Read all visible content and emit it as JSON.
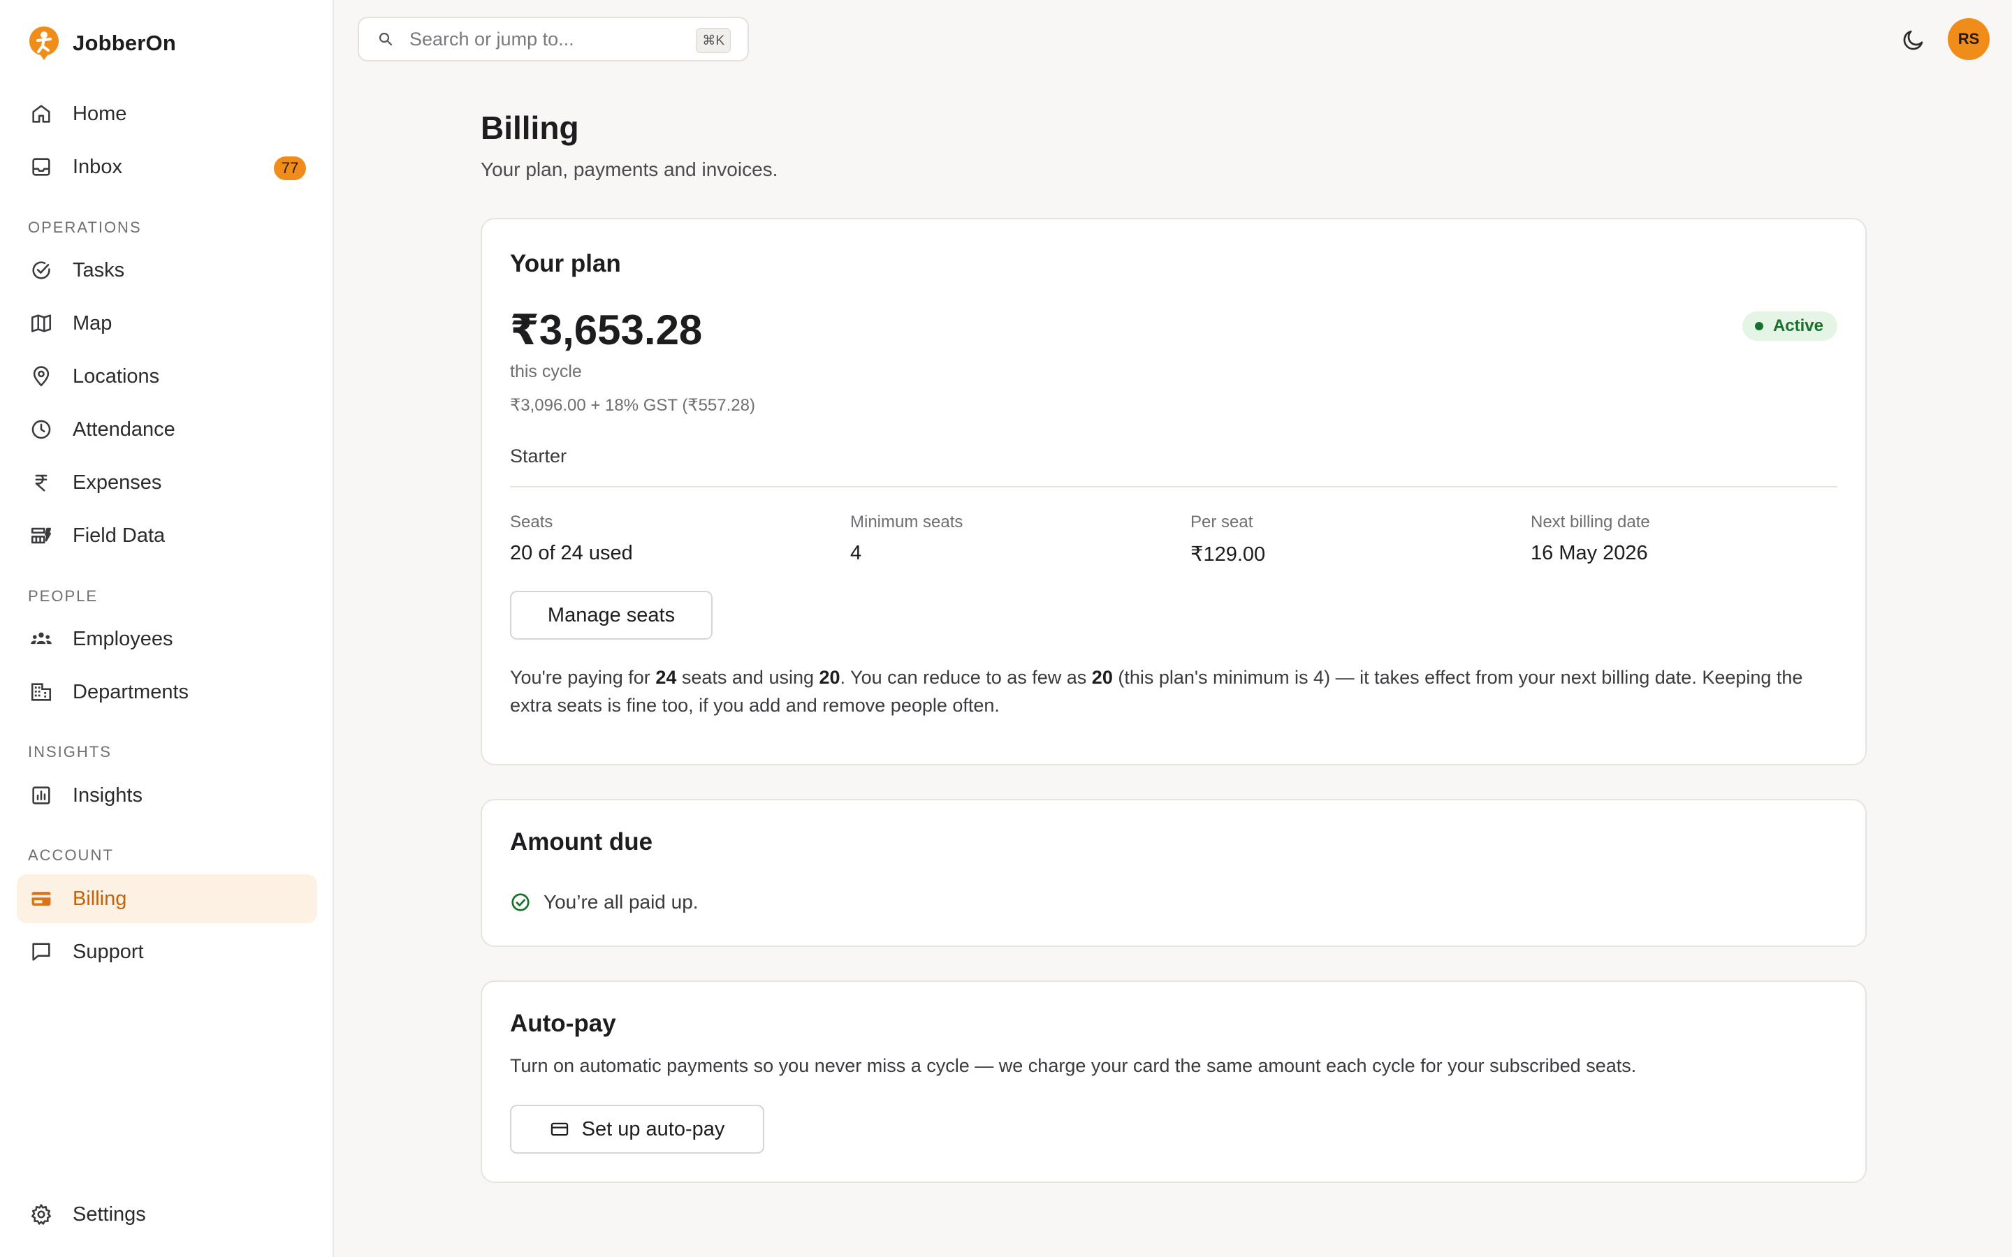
{
  "brand": {
    "name": "JobberOn",
    "accent": "#f08c1a"
  },
  "sidebar": {
    "top_items": [
      {
        "label": "Home",
        "icon": "home-icon"
      },
      {
        "label": "Inbox",
        "icon": "inbox-icon",
        "badge": "77"
      }
    ],
    "sections": [
      {
        "label": "OPERATIONS",
        "items": [
          {
            "label": "Tasks",
            "icon": "check-circle-icon"
          },
          {
            "label": "Map",
            "icon": "map-icon"
          },
          {
            "label": "Locations",
            "icon": "location-pin-icon"
          },
          {
            "label": "Attendance",
            "icon": "clock-icon"
          },
          {
            "label": "Expenses",
            "icon": "rupee-icon"
          },
          {
            "label": "Field Data",
            "icon": "field-data-icon"
          }
        ]
      },
      {
        "label": "PEOPLE",
        "items": [
          {
            "label": "Employees",
            "icon": "people-icon"
          },
          {
            "label": "Departments",
            "icon": "building-icon"
          }
        ]
      },
      {
        "label": "INSIGHTS",
        "items": [
          {
            "label": "Insights",
            "icon": "bar-chart-icon"
          }
        ]
      },
      {
        "label": "ACCOUNT",
        "items": [
          {
            "label": "Billing",
            "icon": "credit-card-icon",
            "active": true
          },
          {
            "label": "Support",
            "icon": "message-icon"
          }
        ]
      }
    ],
    "bottom_items": [
      {
        "label": "Settings",
        "icon": "gear-icon"
      }
    ]
  },
  "topbar": {
    "search_placeholder": "Search or jump to...",
    "search_shortcut": "⌘K",
    "theme_icon": "moon-icon",
    "avatar_initials": "RS"
  },
  "page": {
    "title": "Billing",
    "subtitle": "Your plan, payments and invoices."
  },
  "plan_card": {
    "title": "Your plan",
    "amount": "₹3,653.28",
    "cycle_label": "this cycle",
    "breakdown": "₹3,096.00 + 18% GST (₹557.28)",
    "status": "Active",
    "plan_name": "Starter",
    "stats": [
      {
        "label": "Seats",
        "value": "20 of 24 used"
      },
      {
        "label": "Minimum seats",
        "value": "4"
      },
      {
        "label": "Per seat",
        "value": "₹129.00"
      },
      {
        "label": "Next billing date",
        "value": "16 May 2026"
      }
    ],
    "manage_button": "Manage seats",
    "note": {
      "p1": "You're paying for ",
      "paid_seats": "24",
      "p2": " seats and using ",
      "used_seats": "20",
      "p3": ". You can reduce to as few as ",
      "min_reduce": "20",
      "p4": " (this plan's minimum is 4) — it takes effect from your next billing date. Keeping the extra seats is fine too, if you add and remove people often."
    }
  },
  "amount_due_card": {
    "title": "Amount due",
    "message": "You’re all paid up."
  },
  "autopay_card": {
    "title": "Auto-pay",
    "description": "Turn on automatic payments so you never miss a cycle — we charge your card the same amount each cycle for your subscribed seats.",
    "button": "Set up auto-pay"
  }
}
